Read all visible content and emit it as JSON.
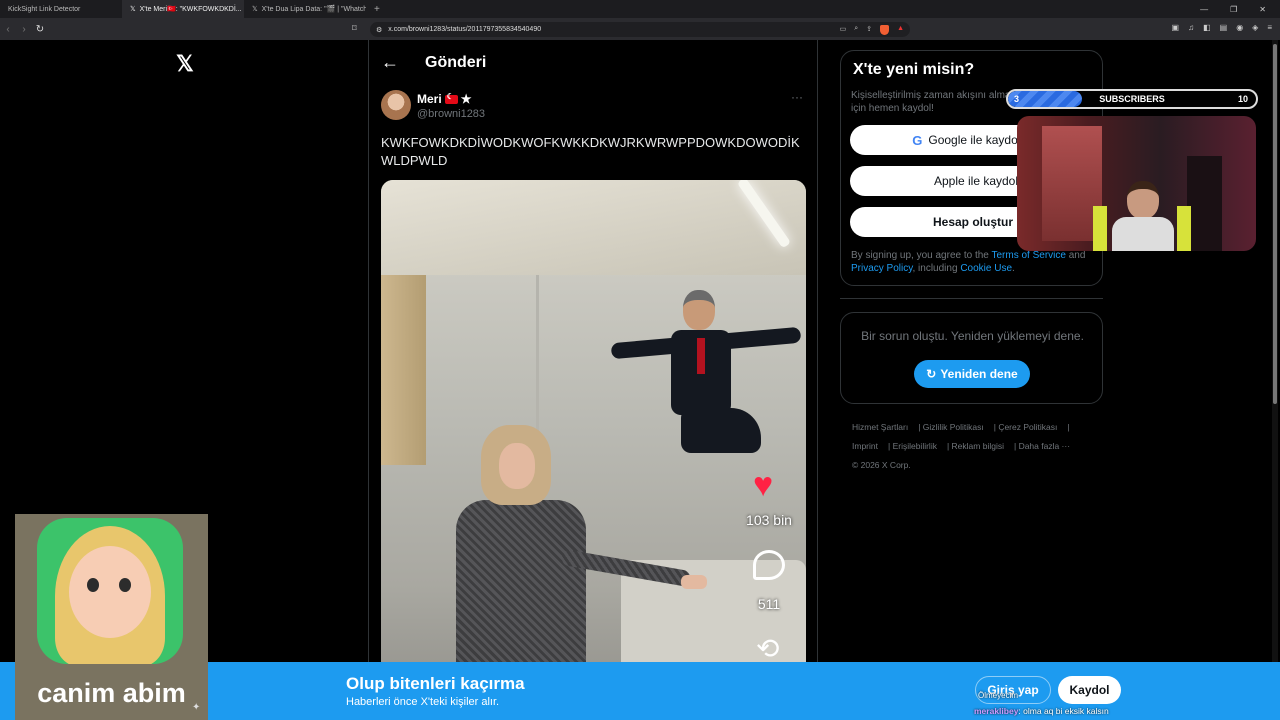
{
  "browser": {
    "tabs": [
      {
        "label": "KickSight Link Detector"
      },
      {
        "label": "X'te Meri🇹🇷: \"KWKFOWKDKDİ..."
      },
      {
        "label": "X'te Dua Lipa Data: \"🎬 | \"Whatcha..."
      }
    ],
    "new_tab": "+",
    "url": "x.com/browni1283/status/2011797355834540490"
  },
  "x": {
    "logo": "𝕏",
    "header_title": "Gönderi",
    "post": {
      "display_name": "Meri",
      "handle": "@browni1283",
      "text": "KWKFOWKDKDİWODKWOFKWKKDKWJRKWRWPPDOWKDOWODİKWLDPWLD",
      "likes": "103 bin",
      "comments": "511"
    },
    "signup_card": {
      "title": "X'te yeni misin?",
      "subtitle": "Kişiselleştirilmiş zaman akışını almak için hemen kaydol!",
      "google_btn": "Google ile kaydolun",
      "apple_btn": "Apple ile kaydol",
      "create_btn": "Hesap oluştur",
      "terms_prefix": "By signing up, you agree to the ",
      "terms_link": "Terms of Service",
      "terms_and": " and ",
      "privacy_link": "Privacy Policy",
      "including": ", including ",
      "cookie_link": "Cookie Use",
      "period": "."
    },
    "error_card": {
      "message": "Bir sorun oluştu. Yeniden yüklemeyi dene.",
      "retry": "Yeniden dene"
    },
    "footer": {
      "links": [
        "Hizmet Şartları",
        "Gizlilik Politikası",
        "Çerez Politikası",
        "Imprint",
        "Erişilebilirlik",
        "Reklam bilgisi",
        "Daha fazla ···"
      ],
      "copyright": "© 2026 X Corp."
    },
    "bottom_bar": {
      "title": "Olup bitenleri kaçırma",
      "subtitle": "Haberleri önce X'teki kişiler alır.",
      "login": "Giriş yap",
      "signup": "Kaydol"
    }
  },
  "stream": {
    "avatar_name": "canim abim",
    "subscribers": {
      "label": "SUBSCRIBERS",
      "current": "3",
      "goal": "10",
      "progress": 0.3
    },
    "chat": [
      {
        "user": "Ölmeyecim",
        "message": ""
      },
      {
        "user": "meraklibey",
        "message": "olma aq bi eksik kalsın"
      }
    ]
  },
  "colors": {
    "accent": "#1d9bf0",
    "heart": "#ff2244",
    "background": "#000000"
  }
}
